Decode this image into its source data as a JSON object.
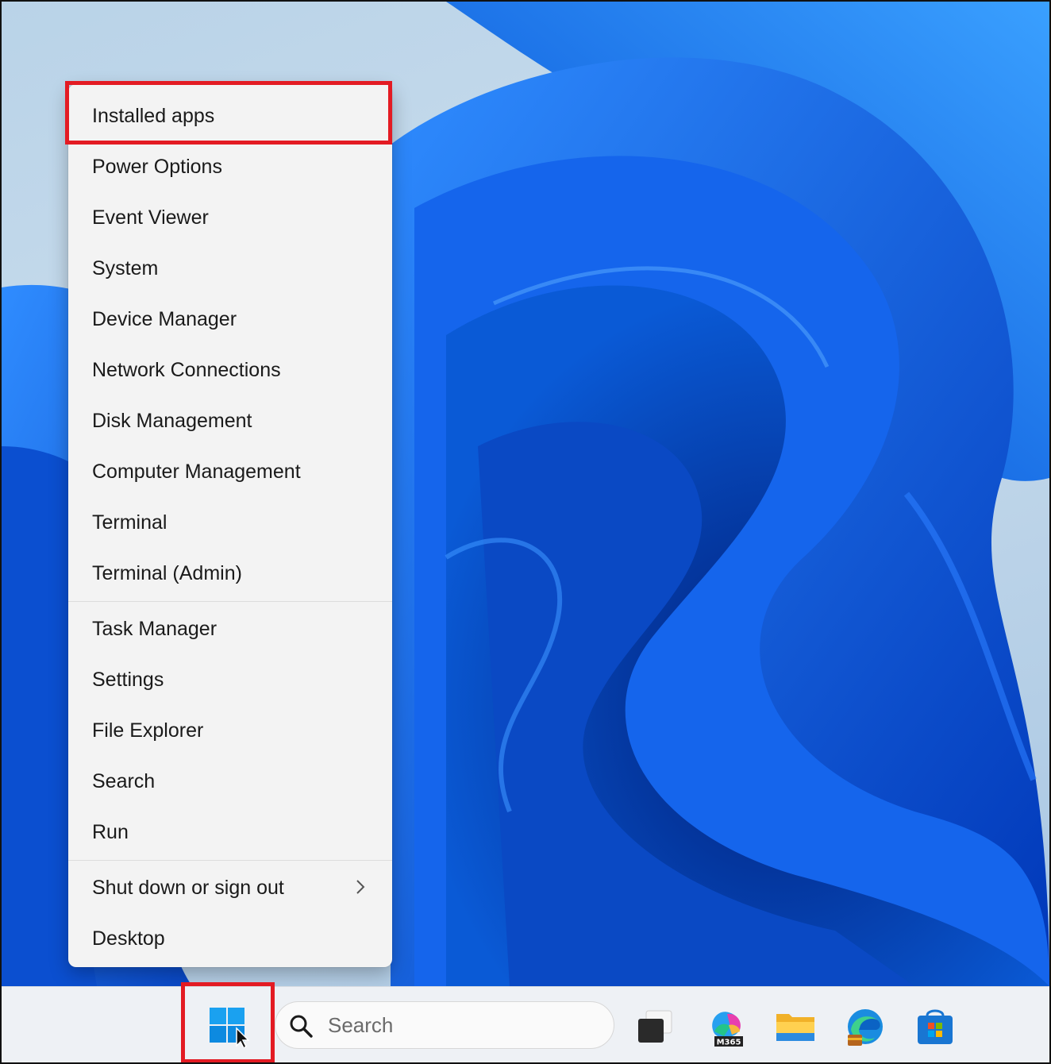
{
  "context_menu": {
    "group1": [
      "Installed apps",
      "Power Options",
      "Event Viewer",
      "System",
      "Device Manager",
      "Network Connections",
      "Disk Management",
      "Computer Management",
      "Terminal",
      "Terminal (Admin)"
    ],
    "group2": [
      "Task Manager",
      "Settings",
      "File Explorer",
      "Search",
      "Run"
    ],
    "group3": [
      "Shut down or sign out",
      "Desktop"
    ]
  },
  "taskbar": {
    "search_placeholder": "Search",
    "copilot_badge": "M365"
  },
  "colors": {
    "highlight_red": "#e31b23",
    "wallpaper_blue": "#0a5ad6",
    "windows_blue": "#1aa1f0"
  }
}
